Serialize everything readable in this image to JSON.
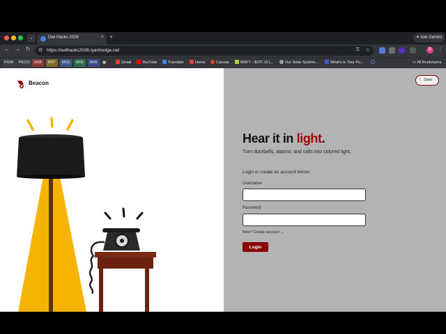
{
  "browser": {
    "tab_title": "Owl Hacks 2026",
    "new_tab_glyph": "+",
    "tab_close_glyph": "×",
    "tab_menu_glyph": "⌄",
    "ask_gemini": "Ask Gemini",
    "url": "https://owlhacks2026.ryanhodge.net",
    "profile_initial": "R",
    "bookmarks": [
      {
        "label": "PGW",
        "color": "#3c4043"
      },
      {
        "label": "PECO",
        "color": "#3c4043"
      },
      {
        "label": "M08",
        "color": "#8a3b3b"
      },
      {
        "label": "M07",
        "color": "#7a6a2a"
      },
      {
        "label": "M10",
        "color": "#3b5a8a"
      },
      {
        "label": "M06",
        "color": "#2d6b4a"
      },
      {
        "label": "M09",
        "color": "#3b4a8a"
      },
      {
        "label": "Gmail",
        "color": "#ea4335"
      },
      {
        "label": "YouTube",
        "color": "#ff0000"
      },
      {
        "label": "Translate",
        "color": "#4285f4"
      },
      {
        "label": "Home",
        "color": "#e04040"
      },
      {
        "label": "Canvas",
        "color": "#e2402b"
      },
      {
        "label": "MSFT - $237.12 |...",
        "color": "#b5d334"
      },
      {
        "label": "Our Solar System...",
        "color": "#9aa0a6"
      },
      {
        "label": "What's in Your Pu...",
        "color": "#3b5bd6"
      },
      {
        "label": "All Bookmarks",
        "color": "#9aa0a6"
      }
    ]
  },
  "page": {
    "brand": "Beacon",
    "theme_toggle": "Dark",
    "headline_pre": "Hear it in ",
    "headline_accent": "light",
    "headline_post": ".",
    "tagline": "Turn doorbells, alarms, and calls into colored light.",
    "login_prompt": "Login or create an account below:",
    "username_label": "Username",
    "username_value": "",
    "password_label": "Password",
    "password_value": "",
    "create_account": "New? Create account →",
    "login_button": "Login"
  },
  "colors": {
    "accent": "#a3000e",
    "button": "#8b0000",
    "lamp_light": "#f5b400",
    "right_panel": "#b3b3b3"
  }
}
